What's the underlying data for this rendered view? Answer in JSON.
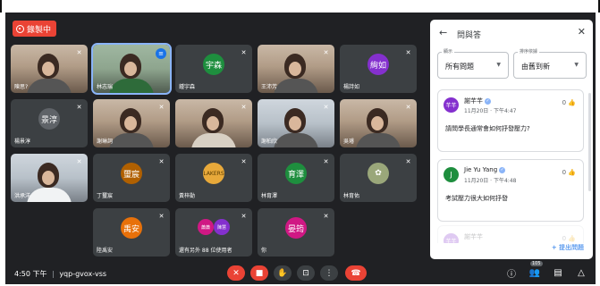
{
  "recording": {
    "label": "錄製中"
  },
  "tiles": [
    {
      "name": "陳思?"
    },
    {
      "name": "林志瑞"
    },
    {
      "name": "鍾宇森",
      "initial": "宇森",
      "color": "#1e8e3e"
    },
    {
      "name": "王沛芳"
    },
    {
      "name": "楊詩如",
      "initial": "絢如",
      "color": "#8430ce"
    },
    {
      "name": "楊景淳",
      "initial": "景淳",
      "color": "#5f6368"
    },
    {
      "name": "謝琳詞"
    },
    {
      "name": ""
    },
    {
      "name": "謝柏欣"
    },
    {
      "name": "吳璿"
    },
    {
      "name": "洪承洋"
    },
    {
      "name": "丁璽宸",
      "initial": "璽宸",
      "color": "#b06000"
    },
    {
      "name": "黃梓勛"
    },
    {
      "name": "林育澤",
      "initial": "育澤",
      "color": "#1e8e3e"
    },
    {
      "name": "林育佑"
    },
    {
      "name": "陸禹安",
      "initial": "禹安",
      "color": "#e8710a"
    },
    {
      "name": "還有另外 88 位使用者"
    },
    {
      "name": "你",
      "initial": "晏筠",
      "color": "#d01884"
    }
  ],
  "group_avatars": [
    {
      "initial": "蕭蕭",
      "color": "#d01884"
    },
    {
      "initial": "陳慧",
      "color": "#8430ce"
    }
  ],
  "bottom": {
    "time": "4:50 下午",
    "separator": "|",
    "meeting_code": "yqp-gvox-vss",
    "people_count": "105"
  },
  "qa": {
    "title": "問與答",
    "show_label": "顯示",
    "show_value": "所有問題",
    "sort_label": "排序依據",
    "sort_value": "由舊到新",
    "questions": [
      {
        "initial": "芊芊",
        "color": "#8430ce",
        "author": "謝芊芊",
        "time": "11月20日 · 下午4:47",
        "votes": "0",
        "text": "請問學長通常會如何抒發壓力?"
      },
      {
        "initial": "J",
        "color": "#1e8e3e",
        "author": "Jie Yu Yang",
        "time": "11月20日 · 下午4:48",
        "votes": "0",
        "text": "考試壓力很大如何抒發"
      },
      {
        "initial": "芊芊",
        "color": "#8430ce",
        "author": "謝芊芊",
        "time": "",
        "votes": "0",
        "text": ""
      }
    ],
    "ask_label": "+ 提出問題"
  }
}
